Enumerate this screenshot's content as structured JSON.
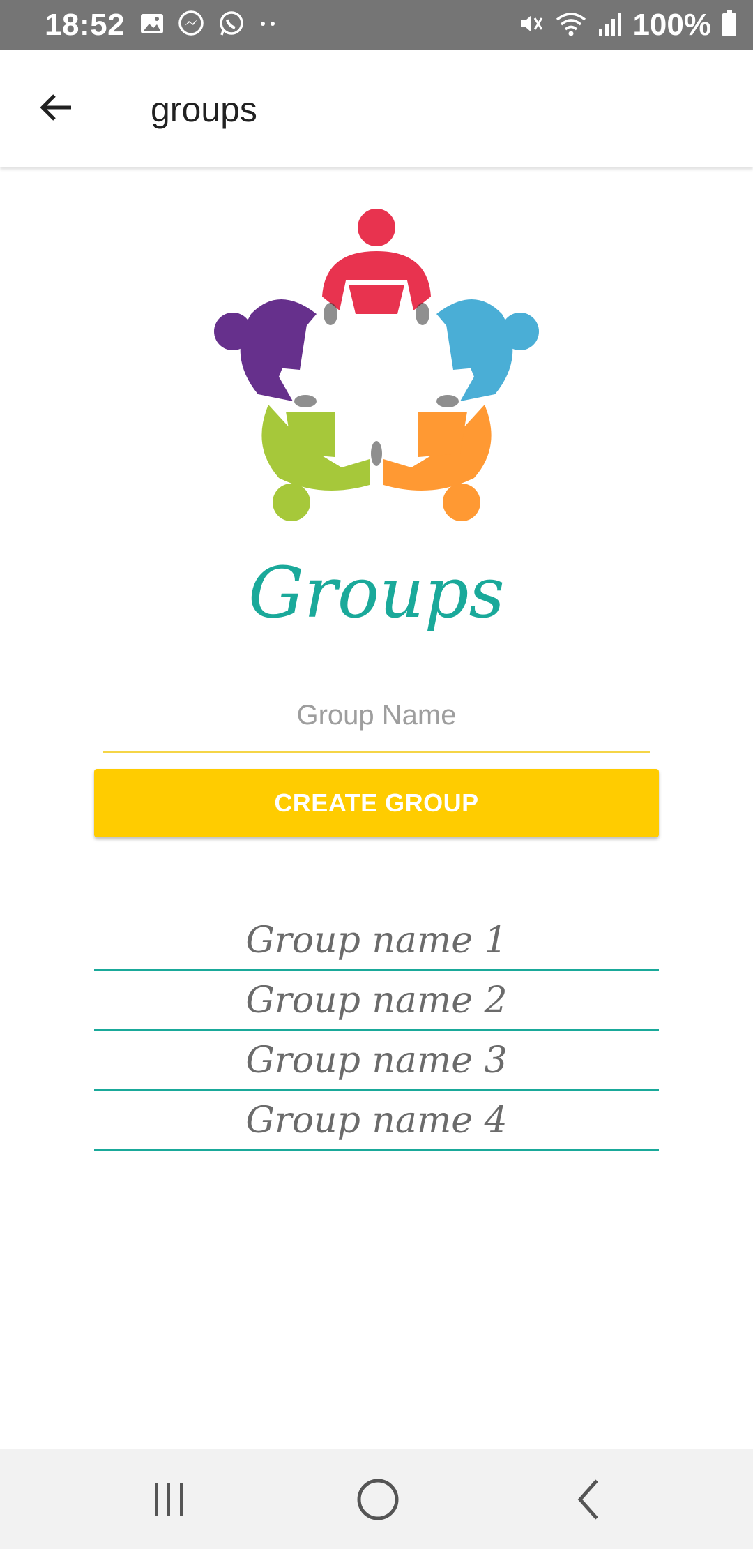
{
  "status_bar": {
    "time": "18:52",
    "battery": "100%",
    "left_icons": [
      "image-icon",
      "messenger-icon",
      "whatsapp-icon",
      "more-dots-icon"
    ],
    "right_icons": [
      "mute-icon",
      "wifi-icon",
      "signal-icon",
      "battery-icon"
    ]
  },
  "app_bar": {
    "title": "groups",
    "back_icon": "arrow-left-icon"
  },
  "logo": {
    "icon": "group-people-circle-logo",
    "colors": [
      "#e8334f",
      "#4aaed6",
      "#ff9933",
      "#a6c83a",
      "#66308c"
    ]
  },
  "heading": "Groups",
  "form": {
    "group_name_placeholder": "Group Name",
    "group_name_value": "",
    "create_button_label": "CREATE GROUP"
  },
  "groups": [
    {
      "name": "Group name 1"
    },
    {
      "name": "Group name 2"
    },
    {
      "name": "Group name 3"
    },
    {
      "name": "Group name 4"
    }
  ],
  "colors": {
    "accent_teal": "#1aa99a",
    "button_yellow": "#ffcc00",
    "input_underline": "#f5d547",
    "status_bar": "#757575"
  },
  "nav_bar": {
    "icons": [
      "recents-icon",
      "home-icon",
      "back-icon"
    ]
  }
}
